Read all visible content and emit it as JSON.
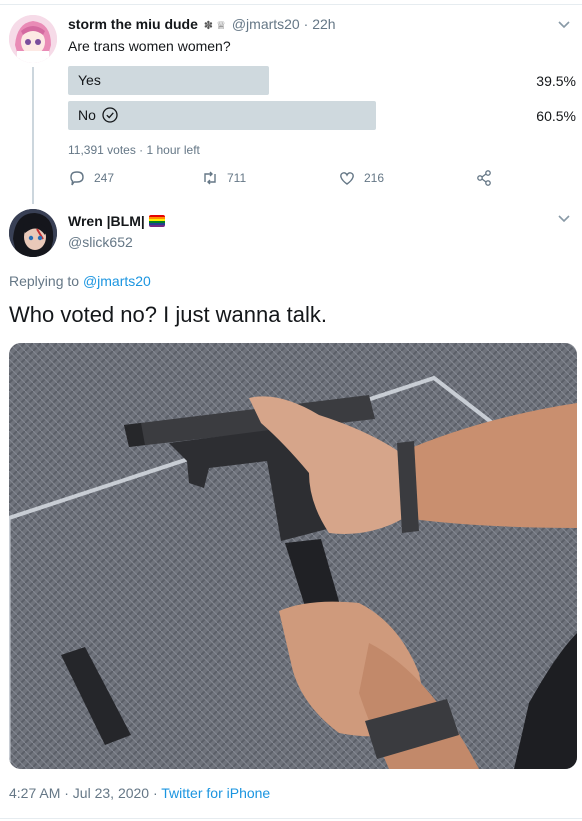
{
  "parent_tweet": {
    "display_name": "storm the miu dude",
    "badges": "✽ ♕",
    "handle": "@jmarts20",
    "separator": "·",
    "time": "22h",
    "text": "Are trans women women?",
    "poll": {
      "options": [
        {
          "label": "Yes",
          "percent": "39.5%",
          "value": 39.5,
          "selected": false
        },
        {
          "label": "No",
          "percent": "60.5%",
          "value": 60.5,
          "selected": true
        }
      ],
      "meta": "11,391 votes · 1 hour left"
    },
    "actions": {
      "replies": "247",
      "retweets": "711",
      "likes": "216"
    }
  },
  "main_tweet": {
    "display_name": "Wren |BLM|",
    "handle": "@slick652",
    "replying_prefix": "Replying to",
    "replying_to": "@jmarts20",
    "text": "Who voted no? I just wanna talk.",
    "footer": {
      "timestamp": "4:27 AM · Jul 23, 2020 ·",
      "source": "Twitter for iPhone"
    }
  },
  "colors": {
    "accent": "#1b95e0",
    "muted": "#657786",
    "poll_bar": "#cfd9de"
  },
  "icons": [
    "chevron-down-icon",
    "reply-icon",
    "retweet-icon",
    "like-icon",
    "share-icon",
    "check-circle-icon",
    "rainbow-flag-icon"
  ]
}
